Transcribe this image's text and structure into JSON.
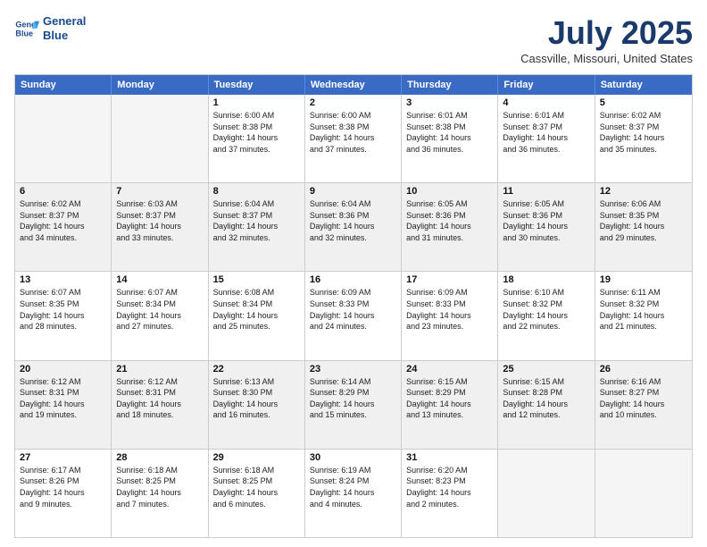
{
  "header": {
    "logo_line1": "General",
    "logo_line2": "Blue",
    "month_title": "July 2025",
    "location": "Cassville, Missouri, United States"
  },
  "weekdays": [
    "Sunday",
    "Monday",
    "Tuesday",
    "Wednesday",
    "Thursday",
    "Friday",
    "Saturday"
  ],
  "rows": [
    [
      {
        "day": "",
        "info": "",
        "shade": "empty"
      },
      {
        "day": "",
        "info": "",
        "shade": "empty"
      },
      {
        "day": "1",
        "info": "Sunrise: 6:00 AM\nSunset: 8:38 PM\nDaylight: 14 hours\nand 37 minutes.",
        "shade": ""
      },
      {
        "day": "2",
        "info": "Sunrise: 6:00 AM\nSunset: 8:38 PM\nDaylight: 14 hours\nand 37 minutes.",
        "shade": ""
      },
      {
        "day": "3",
        "info": "Sunrise: 6:01 AM\nSunset: 8:38 PM\nDaylight: 14 hours\nand 36 minutes.",
        "shade": ""
      },
      {
        "day": "4",
        "info": "Sunrise: 6:01 AM\nSunset: 8:37 PM\nDaylight: 14 hours\nand 36 minutes.",
        "shade": ""
      },
      {
        "day": "5",
        "info": "Sunrise: 6:02 AM\nSunset: 8:37 PM\nDaylight: 14 hours\nand 35 minutes.",
        "shade": ""
      }
    ],
    [
      {
        "day": "6",
        "info": "Sunrise: 6:02 AM\nSunset: 8:37 PM\nDaylight: 14 hours\nand 34 minutes.",
        "shade": "shaded"
      },
      {
        "day": "7",
        "info": "Sunrise: 6:03 AM\nSunset: 8:37 PM\nDaylight: 14 hours\nand 33 minutes.",
        "shade": "shaded"
      },
      {
        "day": "8",
        "info": "Sunrise: 6:04 AM\nSunset: 8:37 PM\nDaylight: 14 hours\nand 32 minutes.",
        "shade": "shaded"
      },
      {
        "day": "9",
        "info": "Sunrise: 6:04 AM\nSunset: 8:36 PM\nDaylight: 14 hours\nand 32 minutes.",
        "shade": "shaded"
      },
      {
        "day": "10",
        "info": "Sunrise: 6:05 AM\nSunset: 8:36 PM\nDaylight: 14 hours\nand 31 minutes.",
        "shade": "shaded"
      },
      {
        "day": "11",
        "info": "Sunrise: 6:05 AM\nSunset: 8:36 PM\nDaylight: 14 hours\nand 30 minutes.",
        "shade": "shaded"
      },
      {
        "day": "12",
        "info": "Sunrise: 6:06 AM\nSunset: 8:35 PM\nDaylight: 14 hours\nand 29 minutes.",
        "shade": "shaded"
      }
    ],
    [
      {
        "day": "13",
        "info": "Sunrise: 6:07 AM\nSunset: 8:35 PM\nDaylight: 14 hours\nand 28 minutes.",
        "shade": ""
      },
      {
        "day": "14",
        "info": "Sunrise: 6:07 AM\nSunset: 8:34 PM\nDaylight: 14 hours\nand 27 minutes.",
        "shade": ""
      },
      {
        "day": "15",
        "info": "Sunrise: 6:08 AM\nSunset: 8:34 PM\nDaylight: 14 hours\nand 25 minutes.",
        "shade": ""
      },
      {
        "day": "16",
        "info": "Sunrise: 6:09 AM\nSunset: 8:33 PM\nDaylight: 14 hours\nand 24 minutes.",
        "shade": ""
      },
      {
        "day": "17",
        "info": "Sunrise: 6:09 AM\nSunset: 8:33 PM\nDaylight: 14 hours\nand 23 minutes.",
        "shade": ""
      },
      {
        "day": "18",
        "info": "Sunrise: 6:10 AM\nSunset: 8:32 PM\nDaylight: 14 hours\nand 22 minutes.",
        "shade": ""
      },
      {
        "day": "19",
        "info": "Sunrise: 6:11 AM\nSunset: 8:32 PM\nDaylight: 14 hours\nand 21 minutes.",
        "shade": ""
      }
    ],
    [
      {
        "day": "20",
        "info": "Sunrise: 6:12 AM\nSunset: 8:31 PM\nDaylight: 14 hours\nand 19 minutes.",
        "shade": "shaded"
      },
      {
        "day": "21",
        "info": "Sunrise: 6:12 AM\nSunset: 8:31 PM\nDaylight: 14 hours\nand 18 minutes.",
        "shade": "shaded"
      },
      {
        "day": "22",
        "info": "Sunrise: 6:13 AM\nSunset: 8:30 PM\nDaylight: 14 hours\nand 16 minutes.",
        "shade": "shaded"
      },
      {
        "day": "23",
        "info": "Sunrise: 6:14 AM\nSunset: 8:29 PM\nDaylight: 14 hours\nand 15 minutes.",
        "shade": "shaded"
      },
      {
        "day": "24",
        "info": "Sunrise: 6:15 AM\nSunset: 8:29 PM\nDaylight: 14 hours\nand 13 minutes.",
        "shade": "shaded"
      },
      {
        "day": "25",
        "info": "Sunrise: 6:15 AM\nSunset: 8:28 PM\nDaylight: 14 hours\nand 12 minutes.",
        "shade": "shaded"
      },
      {
        "day": "26",
        "info": "Sunrise: 6:16 AM\nSunset: 8:27 PM\nDaylight: 14 hours\nand 10 minutes.",
        "shade": "shaded"
      }
    ],
    [
      {
        "day": "27",
        "info": "Sunrise: 6:17 AM\nSunset: 8:26 PM\nDaylight: 14 hours\nand 9 minutes.",
        "shade": ""
      },
      {
        "day": "28",
        "info": "Sunrise: 6:18 AM\nSunset: 8:25 PM\nDaylight: 14 hours\nand 7 minutes.",
        "shade": ""
      },
      {
        "day": "29",
        "info": "Sunrise: 6:18 AM\nSunset: 8:25 PM\nDaylight: 14 hours\nand 6 minutes.",
        "shade": ""
      },
      {
        "day": "30",
        "info": "Sunrise: 6:19 AM\nSunset: 8:24 PM\nDaylight: 14 hours\nand 4 minutes.",
        "shade": ""
      },
      {
        "day": "31",
        "info": "Sunrise: 6:20 AM\nSunset: 8:23 PM\nDaylight: 14 hours\nand 2 minutes.",
        "shade": ""
      },
      {
        "day": "",
        "info": "",
        "shade": "empty"
      },
      {
        "day": "",
        "info": "",
        "shade": "empty"
      }
    ]
  ]
}
